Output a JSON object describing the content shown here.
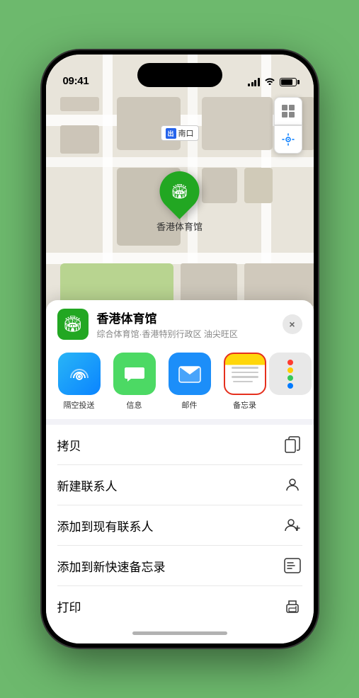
{
  "status_bar": {
    "time": "09:41",
    "location_arrow": "▸"
  },
  "map": {
    "label_exit": "出",
    "label_name": "南口",
    "pin_venue": "香港体育馆",
    "controls": {
      "map_icon": "⊞",
      "location_icon": "◎"
    }
  },
  "bottom_sheet": {
    "venue_icon": "🏟",
    "venue_name": "香港体育馆",
    "venue_subtitle": "综合体育馆·香港特别行政区 油尖旺区",
    "close_label": "×",
    "share_items": [
      {
        "label": "隔空投送",
        "type": "airdrop"
      },
      {
        "label": "信息",
        "type": "messages"
      },
      {
        "label": "邮件",
        "type": "mail"
      },
      {
        "label": "备忘录",
        "type": "notes"
      }
    ],
    "action_items": [
      {
        "label": "拷贝",
        "icon": "copy"
      },
      {
        "label": "新建联系人",
        "icon": "contact-add"
      },
      {
        "label": "添加到现有联系人",
        "icon": "contact-plus"
      },
      {
        "label": "添加到新快速备忘录",
        "icon": "quick-note"
      },
      {
        "label": "打印",
        "icon": "print"
      }
    ]
  }
}
